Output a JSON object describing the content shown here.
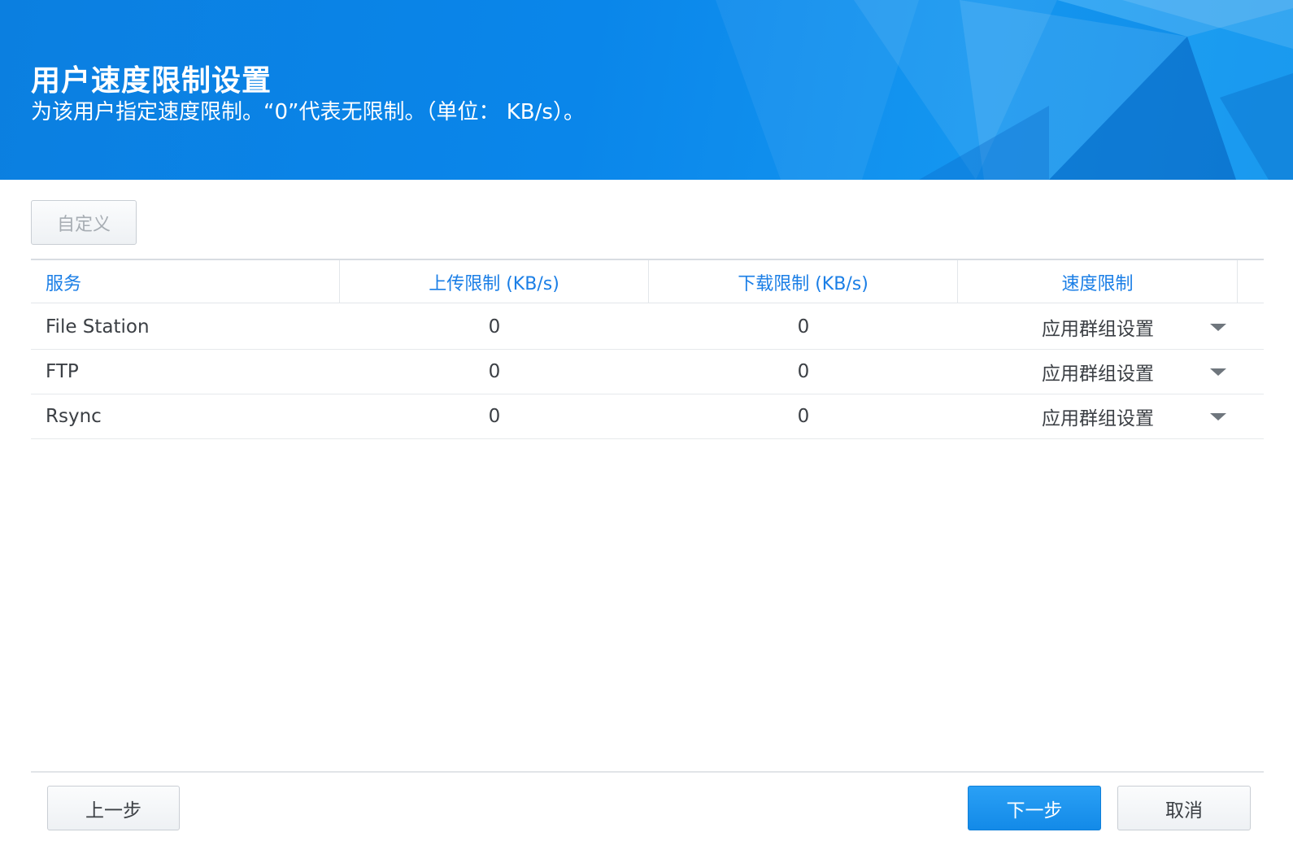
{
  "header": {
    "title": "用户速度限制设置",
    "subtitle": "为该用户指定速度限制。“0”代表无限制。（单位： KB/s）。"
  },
  "toolbar": {
    "custom_label": "自定义"
  },
  "grid": {
    "columns": [
      "服务",
      "上传限制 (KB/s)",
      "下载限制 (KB/s)",
      "速度限制"
    ],
    "rows": [
      {
        "service": "File Station",
        "upload": "0",
        "download": "0",
        "speed": "应用群组设置"
      },
      {
        "service": "FTP",
        "upload": "0",
        "download": "0",
        "speed": "应用群组设置"
      },
      {
        "service": "Rsync",
        "upload": "0",
        "download": "0",
        "speed": "应用群组设置"
      }
    ]
  },
  "footer": {
    "prev_label": "上一步",
    "next_label": "下一步",
    "cancel_label": "取消"
  },
  "colors": {
    "accent": "#1a7ee6",
    "header_bg": "#0a86ea",
    "primary_button": "#1e93ee"
  },
  "icons": {
    "dropdown": "chevron-down-icon"
  }
}
